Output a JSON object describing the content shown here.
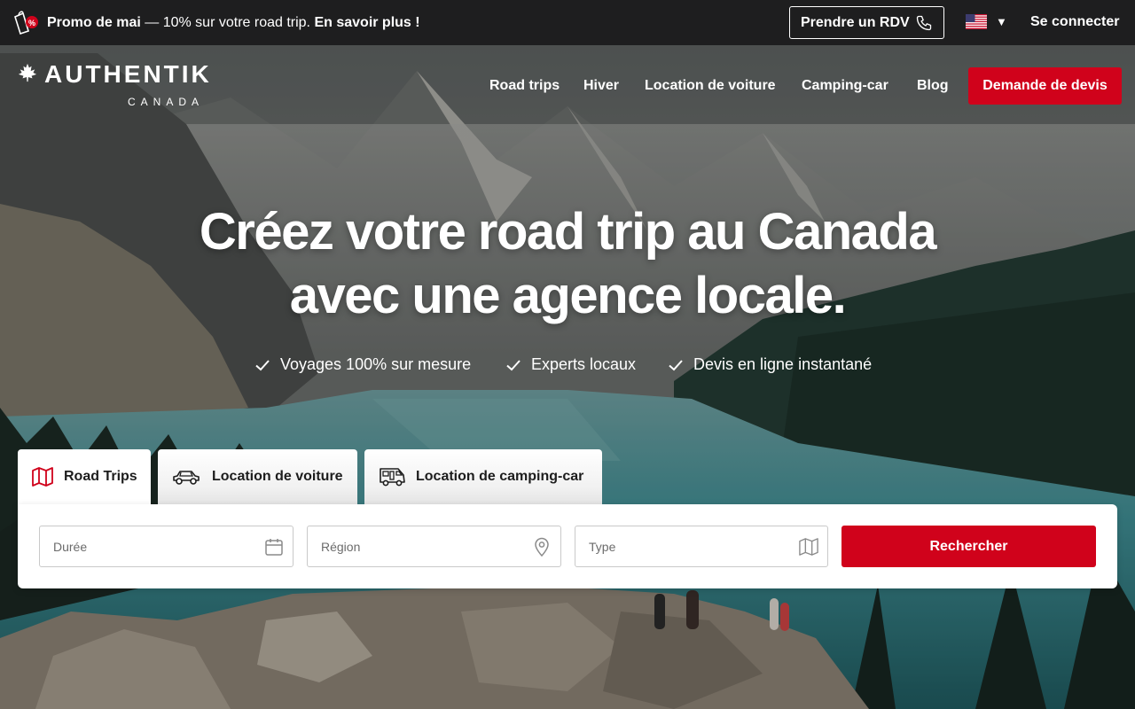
{
  "promo": {
    "title": "Promo de mai",
    "separator": " — ",
    "text": "10% sur votre road trip.",
    "link": "En savoir plus !"
  },
  "topbar": {
    "rdv_label": "Prendre un RDV",
    "language_icon": "us-flag-icon",
    "login_label": "Se connecter"
  },
  "logo": {
    "main": "AUTHENTIK",
    "sub": "CANADA"
  },
  "nav": {
    "items": [
      "Road trips",
      "Hiver",
      "Location de voiture",
      "Camping-car",
      "Blog"
    ],
    "cta": "Demande de devis"
  },
  "hero": {
    "title_line1": "Créez votre road trip au Canada",
    "title_line2": "avec une agence locale.",
    "features": [
      "Voyages 100% sur mesure",
      "Experts locaux",
      "Devis en ligne instantané"
    ]
  },
  "search": {
    "tabs": [
      {
        "label": "Road Trips",
        "icon": "map-icon",
        "active": true
      },
      {
        "label": "Location de voiture",
        "icon": "car-icon",
        "active": false
      },
      {
        "label": "Location de camping-car",
        "icon": "camper-van-icon",
        "active": false
      }
    ],
    "fields": [
      {
        "placeholder": "Durée",
        "icon": "calendar-icon"
      },
      {
        "placeholder": "Région",
        "icon": "location-pin-icon"
      },
      {
        "placeholder": "Type",
        "icon": "map-icon"
      }
    ],
    "button": "Rechercher"
  },
  "colors": {
    "brand_red": "#d0021b",
    "topbar_bg": "#1e1e1f",
    "lake": "#3f8d93"
  }
}
